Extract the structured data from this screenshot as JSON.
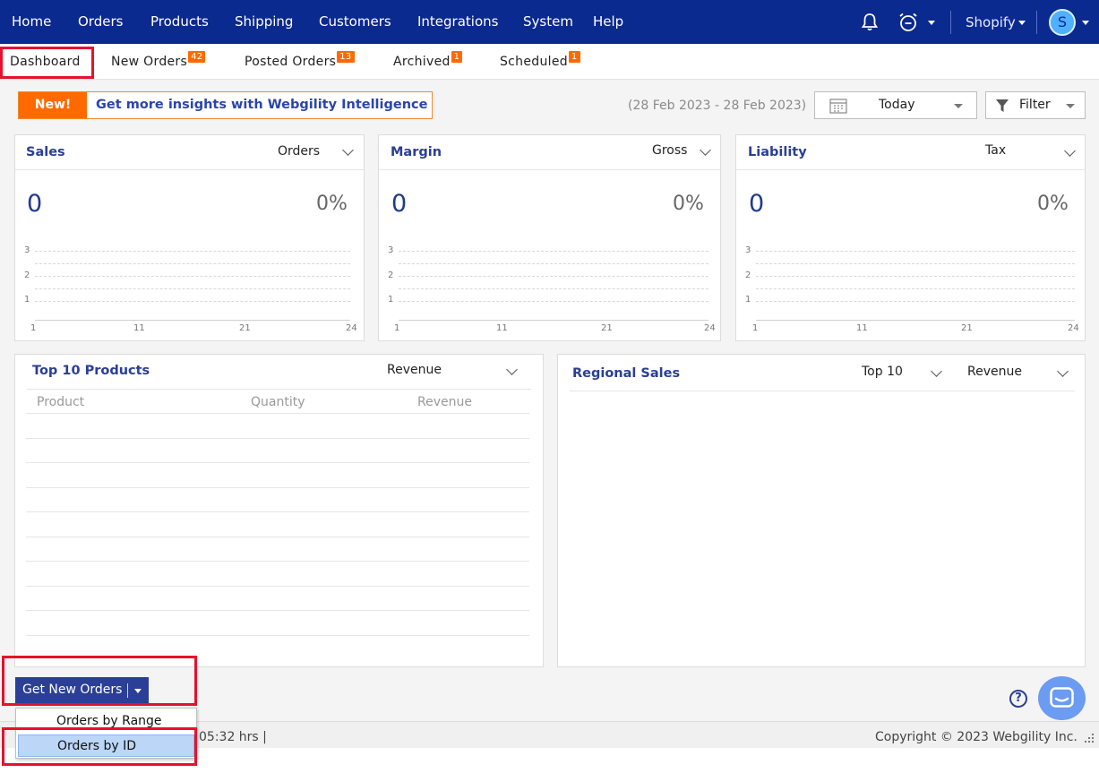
{
  "nav": {
    "items": [
      "Home",
      "Orders",
      "Products",
      "Shipping",
      "Customers",
      "Integrations",
      "System",
      "Help"
    ],
    "store": "Shopify",
    "avatar_initial": "S",
    "icons": [
      "bell-icon",
      "alarm-clock-icon",
      "chevron-down-icon",
      "user-avatar"
    ]
  },
  "tabs": [
    {
      "label": "Dashboard",
      "badge": ""
    },
    {
      "label": "New Orders",
      "badge": "42"
    },
    {
      "label": "Posted Orders",
      "badge": "13"
    },
    {
      "label": "Archived",
      "badge": "1"
    },
    {
      "label": "Scheduled",
      "badge": "1"
    }
  ],
  "promo": {
    "new_label": "New!",
    "text": "Get more insights with Webgility Intelligence"
  },
  "date_range": "(28 Feb 2023 - 28 Feb 2023)",
  "date_select": "Today",
  "filter_label": "Filter",
  "cards": [
    {
      "title": "Sales",
      "select": "Orders",
      "value": "0",
      "percent": "0%"
    },
    {
      "title": "Margin",
      "select": "Gross",
      "value": "0",
      "percent": "0%"
    },
    {
      "title": "Liability",
      "select": "Tax",
      "value": "0",
      "percent": "0%"
    }
  ],
  "mini_axis": {
    "y_ticks": [
      "3",
      "2",
      "1"
    ],
    "x_ticks": [
      "1",
      "11",
      "21",
      "24"
    ]
  },
  "top_products": {
    "title": "Top 10 Products",
    "select": "Revenue",
    "columns": [
      "Product",
      "Quantity",
      "Revenue"
    ],
    "rows": []
  },
  "regional": {
    "title": "Regional Sales",
    "select_count": "Top 10",
    "select_metric": "Revenue"
  },
  "get_orders": {
    "label": "Get New Orders",
    "menu": [
      "Orders by Range",
      "Orders by ID"
    ]
  },
  "status": {
    "timer": "05:32 hrs |",
    "copyright": "Copyright © 2023 Webgility Inc."
  },
  "help_glyph": "?",
  "colors": {
    "nav_bg": "#0b2a8f",
    "accent_orange": "#ff6a00",
    "title_blue": "#2a3f95",
    "highlight_red": "#e8112d",
    "selected_item": "#bcd6f7"
  }
}
